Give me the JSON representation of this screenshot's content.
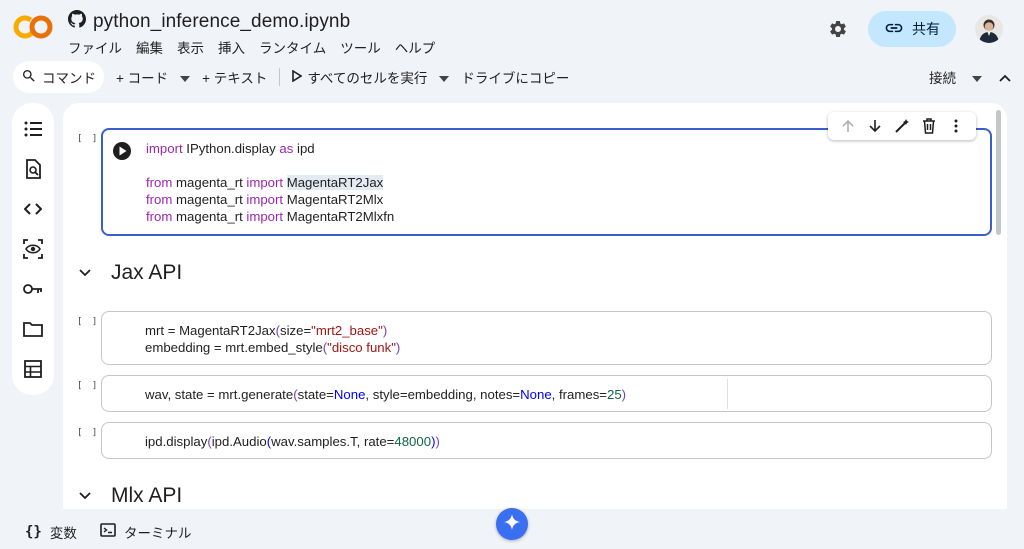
{
  "app": {
    "notebook_title": "python_inference_demo.ipynb",
    "brand_color": "#f9ab00",
    "accent_color": "#3b5fc9"
  },
  "menu": [
    "ファイル",
    "編集",
    "表示",
    "挿入",
    "ランタイム",
    "ツール",
    "ヘルプ"
  ],
  "header": {
    "share_label": "共有",
    "settings_icon": "gear-icon",
    "avatar_icon": "user-avatar"
  },
  "toolbar": {
    "command_label": "コマンド",
    "add_code_label": "+ コード",
    "add_text_label": "+ テキスト",
    "run_all_label": "すべてのセルを実行",
    "copy_to_drive_label": "ドライブにコピー",
    "connect_label": "接続"
  },
  "rail": {
    "items": [
      "table-of-contents-icon",
      "find-icon",
      "code-snippets-icon",
      "variables-inspector-icon",
      "secrets-key-icon",
      "files-icon",
      "data-table-icon"
    ]
  },
  "cells": [
    {
      "bracket": "[ ]",
      "lines": [
        [
          {
            "t": "import",
            "c": "kw"
          },
          {
            "t": " IPython.display "
          },
          {
            "t": "as",
            "c": "kw"
          },
          {
            "t": " ipd"
          }
        ],
        [],
        [
          {
            "t": "from",
            "c": "kw"
          },
          {
            "t": " magenta_rt "
          },
          {
            "t": "import",
            "c": "kw"
          },
          {
            "t": " "
          },
          {
            "t": "MagentaRT2Jax",
            "c": "hl"
          }
        ],
        [
          {
            "t": "from",
            "c": "kw"
          },
          {
            "t": " magenta_rt "
          },
          {
            "t": "import",
            "c": "kw"
          },
          {
            "t": " MagentaRT2Mlx"
          }
        ],
        [
          {
            "t": "from",
            "c": "kw"
          },
          {
            "t": " magenta_rt "
          },
          {
            "t": "import",
            "c": "kw"
          },
          {
            "t": " MagentaRT2Mlxfn"
          }
        ]
      ]
    },
    {
      "bracket": "[ ]",
      "lines": [
        [
          {
            "t": "mrt = MagentaRT2Jax"
          },
          {
            "t": "(",
            "c": "p2"
          },
          {
            "t": "size="
          },
          {
            "t": "\"mrt2_base\"",
            "c": "str"
          },
          {
            "t": ")",
            "c": "p2"
          }
        ],
        [
          {
            "t": "embedding = mrt.embed_style"
          },
          {
            "t": "(",
            "c": "p2"
          },
          {
            "t": "\"disco funk\"",
            "c": "str"
          },
          {
            "t": ")",
            "c": "p2"
          }
        ]
      ]
    },
    {
      "bracket": "[ ]",
      "lines": [
        [
          {
            "t": "wav, state = mrt.generate"
          },
          {
            "t": "(",
            "c": "p2"
          },
          {
            "t": "state="
          },
          {
            "t": "None",
            "c": "bi"
          },
          {
            "t": ", style=embedding, notes="
          },
          {
            "t": "None",
            "c": "bi"
          },
          {
            "t": ", frames="
          },
          {
            "t": "25",
            "c": "num"
          },
          {
            "t": ")",
            "c": "p2"
          }
        ]
      ]
    },
    {
      "bracket": "[ ]",
      "lines": [
        [
          {
            "t": "ipd.display"
          },
          {
            "t": "(",
            "c": "p2"
          },
          {
            "t": "ipd.Audio"
          },
          {
            "t": "(",
            "c": "bi"
          },
          {
            "t": "wav.samples.T, rate="
          },
          {
            "t": "48000",
            "c": "num"
          },
          {
            "t": ")",
            "c": "bi"
          },
          {
            "t": ")",
            "c": "p2"
          }
        ]
      ]
    }
  ],
  "sections": {
    "jax": "Jax API",
    "mlx": "Mlx API"
  },
  "bottom": {
    "variables_label": "変数",
    "terminal_label": "ターミナル"
  }
}
